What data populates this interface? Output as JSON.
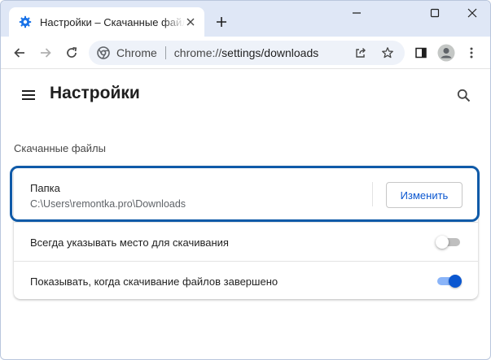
{
  "window": {
    "tab_title": "Настройки – Скачанные файлы",
    "tab_icon": "settings-gear-icon",
    "new_tab_label": "+"
  },
  "toolbar": {
    "site_chip": "Chrome",
    "url_host": "chrome://",
    "url_path": "settings/downloads"
  },
  "header": {
    "title": "Настройки"
  },
  "downloads": {
    "section_title": "Скачанные файлы",
    "folder_label": "Папка",
    "folder_path": "C:\\Users\\remontka.pro\\Downloads",
    "change_button": "Изменить",
    "ask_where_label": "Всегда указывать место для скачивания",
    "ask_where_enabled": false,
    "show_when_done_label": "Показывать, когда скачивание файлов завершено",
    "show_when_done_enabled": true
  },
  "colors": {
    "accent": "#0b57d0",
    "highlight_border": "#0f5aa8",
    "tabstrip": "#dfe7f6"
  }
}
